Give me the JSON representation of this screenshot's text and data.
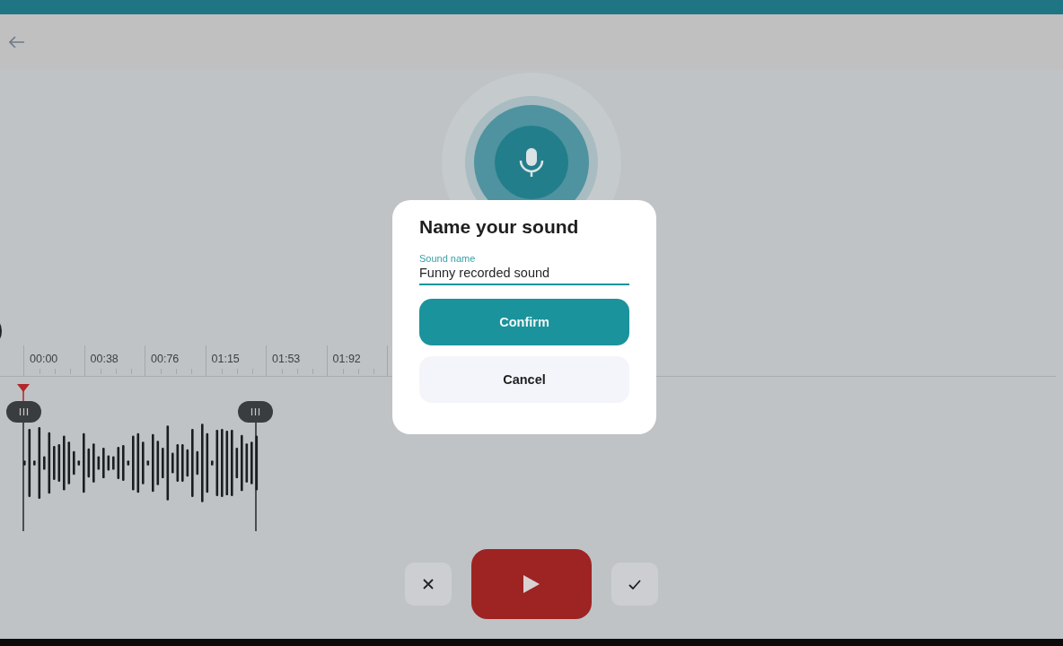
{
  "timeline": {
    "labels": [
      "00:00",
      "00:38",
      "00:76",
      "01:15",
      "01:53",
      "01:92"
    ]
  },
  "dialog": {
    "title": "Name your sound",
    "field": {
      "label": "Sound name",
      "value": "Funny recorded sound",
      "focused": true
    },
    "buttons": [
      {
        "label": "Confirm",
        "kind": "primary"
      },
      {
        "label": "Cancel",
        "kind": "secondary"
      }
    ]
  }
}
